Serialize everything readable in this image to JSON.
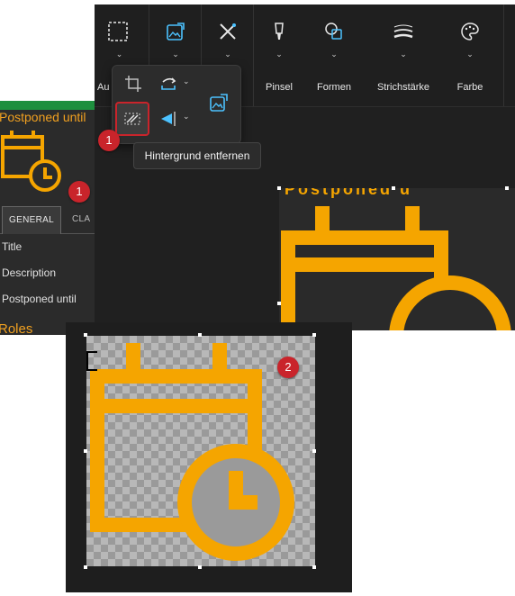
{
  "left_panel": {
    "title": "Postponed until",
    "tabs": {
      "general": "GENERAL",
      "other": "CLA"
    },
    "fields": [
      "Title",
      "Description",
      "Postponed until"
    ],
    "roles": "Roles",
    "badge": "1"
  },
  "toolbar": {
    "groups": [
      {
        "label": "Au",
        "icon": "select-icon"
      },
      {
        "label": "",
        "icon": "image-icon"
      },
      {
        "label": "",
        "icon": "tools-icon"
      },
      {
        "label": "Pinsel",
        "icon": "brush-icon"
      },
      {
        "label": "Formen",
        "icon": "shapes-icon"
      },
      {
        "label": "Strichstärke",
        "icon": "stroke-icon"
      },
      {
        "label": "Farbe",
        "icon": "palette-icon"
      }
    ]
  },
  "dropdown": {
    "badge": "1",
    "tooltip": "Hintergrund entfernen"
  },
  "canvas": {
    "visible_text": "Postponed u"
  },
  "result": {
    "badge": "2"
  },
  "colors": {
    "accent_orange": "#f5a500",
    "badge_red": "#c9242b",
    "dark_bg": "#202020"
  }
}
